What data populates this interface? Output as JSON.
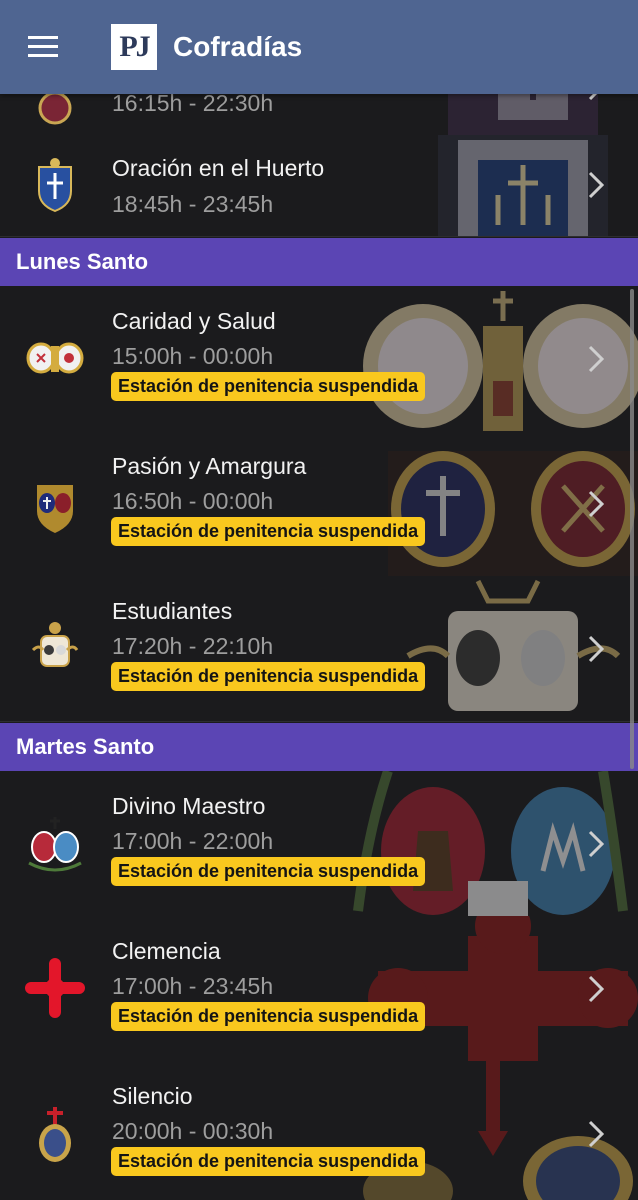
{
  "app": {
    "title": "Cofradías",
    "logo_text": "PJ"
  },
  "icons": {
    "menu": "hamburger-menu-icon",
    "chevron": "chevron-right-icon"
  },
  "colors": {
    "appbar": "#4f6591",
    "section": "#5b45b4",
    "badge": "#f9c81e",
    "background": "#1b1b1d"
  },
  "rows_before": [
    {
      "name": "",
      "time": "16:15h - 22:30h",
      "badge": ""
    },
    {
      "name": "Oración en el Huerto",
      "time": "18:45h - 23:45h",
      "badge": ""
    }
  ],
  "sections": [
    {
      "title": "Lunes Santo",
      "items": [
        {
          "name": "Caridad y Salud",
          "time": "15:00h - 00:00h",
          "badge": "Estación de penitencia suspendida"
        },
        {
          "name": "Pasión y Amargura",
          "time": "16:50h - 00:00h",
          "badge": "Estación de penitencia suspendida"
        },
        {
          "name": "Estudiantes",
          "time": "17:20h - 22:10h",
          "badge": "Estación de penitencia suspendida"
        }
      ]
    },
    {
      "title": "Martes Santo",
      "items": [
        {
          "name": "Divino Maestro",
          "time": "17:00h - 22:00h",
          "badge": "Estación de penitencia suspendida"
        },
        {
          "name": "Clemencia",
          "time": "17:00h - 23:45h",
          "badge": "Estación de penitencia suspendida"
        },
        {
          "name": "Silencio",
          "time": "20:00h - 00:30h",
          "badge": "Estación de penitencia suspendida"
        }
      ]
    }
  ]
}
